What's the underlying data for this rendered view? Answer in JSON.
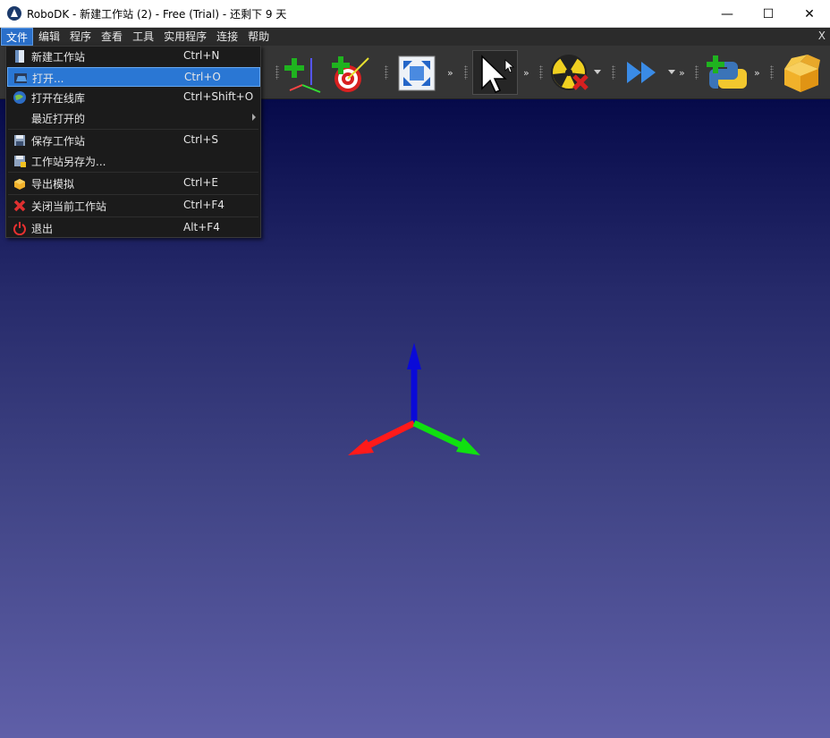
{
  "window": {
    "title": "RoboDK - 新建工作站 (2) - Free (Trial) - 还剩下 9 天",
    "minimize_glyph": "—",
    "maximize_glyph": "☐",
    "close_glyph": "✕"
  },
  "menubar": {
    "items": [
      "文件",
      "编辑",
      "程序",
      "查看",
      "工具",
      "实用程序",
      "连接",
      "帮助"
    ],
    "active_index": 0,
    "close_glyph": "X"
  },
  "toolbar": {
    "chevron": "»",
    "icons": [
      "add-reference-frame-icon",
      "add-target-icon",
      "fit-all-icon",
      "select-pointer-icon",
      "collision-icon",
      "run-program-icon",
      "add-python-icon",
      "open-library-icon"
    ]
  },
  "file_menu": {
    "items": [
      {
        "label": "新建工作站",
        "shortcut": "Ctrl+N",
        "icon": "new-station-icon"
      },
      {
        "label": "打开...",
        "shortcut": "Ctrl+O",
        "icon": "open-icon"
      },
      {
        "label": "打开在线库",
        "shortcut": "Ctrl+Shift+O",
        "icon": "online-library-icon"
      },
      {
        "label": "最近打开的",
        "shortcut": "",
        "icon": ""
      },
      {
        "label": "保存工作站",
        "shortcut": "Ctrl+S",
        "icon": "save-icon"
      },
      {
        "label": "工作站另存为...",
        "shortcut": "",
        "icon": "save-as-icon"
      },
      {
        "label": "导出模拟",
        "shortcut": "Ctrl+E",
        "icon": "export-simulation-icon"
      },
      {
        "label": "关闭当前工作站",
        "shortcut": "Ctrl+F4",
        "icon": "close-station-icon"
      },
      {
        "label": "退出",
        "shortcut": "Alt+F4",
        "icon": "power-icon"
      }
    ],
    "highlighted_index": 1
  },
  "colors": {
    "axis_x": "#ff1a1a",
    "axis_y": "#10e010",
    "axis_z": "#0a0ad8",
    "menu_highlight": "#2a77d4"
  }
}
